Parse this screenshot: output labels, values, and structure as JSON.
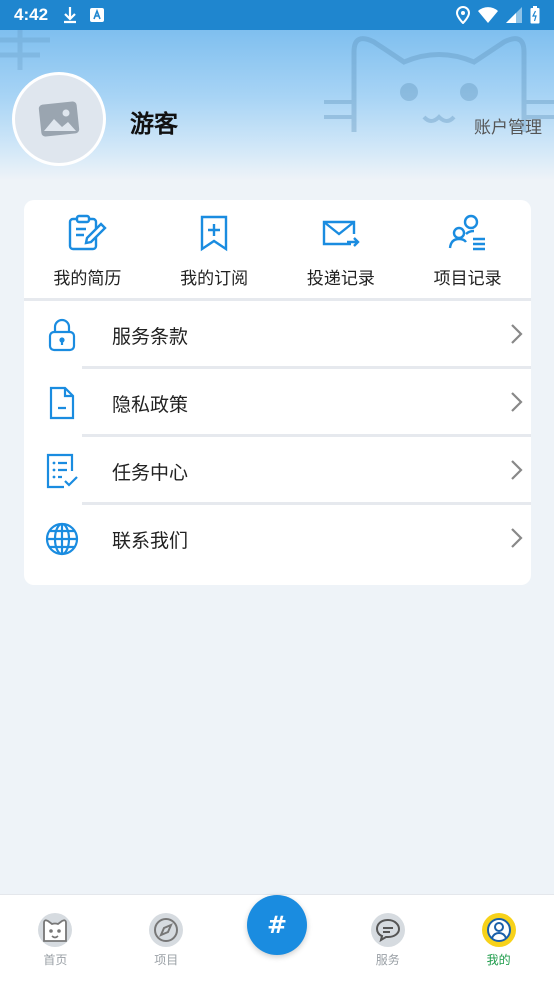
{
  "status_bar": {
    "time": "4:42"
  },
  "profile": {
    "username": "游客",
    "account_link": "账户管理"
  },
  "shortcuts": [
    {
      "label": "我的简历",
      "icon": "resume-icon"
    },
    {
      "label": "我的订阅",
      "icon": "bookmark-add-icon"
    },
    {
      "label": "投递记录",
      "icon": "mail-send-icon"
    },
    {
      "label": "项目记录",
      "icon": "users-list-icon"
    }
  ],
  "menu": [
    {
      "label": "服务条款",
      "icon": "lock-icon"
    },
    {
      "label": "隐私政策",
      "icon": "document-icon"
    },
    {
      "label": "任务中心",
      "icon": "checklist-icon"
    },
    {
      "label": "联系我们",
      "icon": "globe-icon"
    }
  ],
  "bottom_nav": [
    {
      "label": "首页",
      "icon": "cat-icon"
    },
    {
      "label": "项目",
      "icon": "compass-icon"
    },
    {
      "label": "服务",
      "icon": "chat-icon"
    },
    {
      "label": "我的",
      "icon": "user-icon",
      "active": true
    }
  ],
  "fab": {
    "label": "#"
  },
  "colors": {
    "accent": "#1a8ce0",
    "active_nav": "#1d9b4a",
    "status_bar": "#1f86cf"
  }
}
